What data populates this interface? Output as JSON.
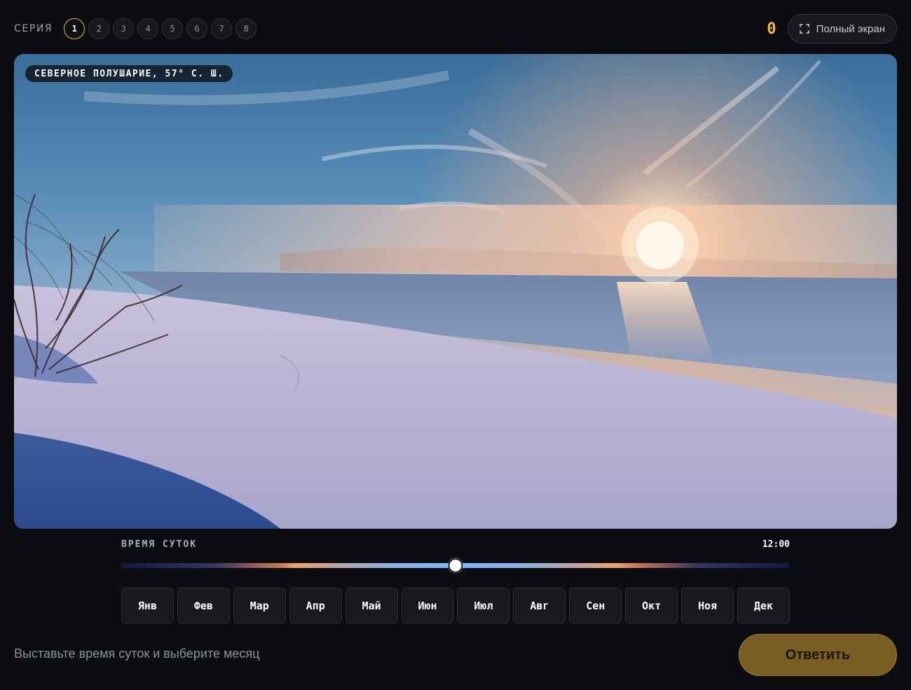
{
  "header": {
    "series_label": "СЕРИЯ",
    "rounds": [
      "1",
      "2",
      "3",
      "4",
      "5",
      "6",
      "7",
      "8"
    ],
    "active_round": 1,
    "score": "0",
    "fullscreen_label": "Полный экран",
    "fullscreen_icon": "fullscreen-icon"
  },
  "photo": {
    "location_chip": "СЕВЕРНОЕ ПОЛУШАРИЕ, 57° С. Ш."
  },
  "time": {
    "label": "ВРЕМЯ СУТОК",
    "value": "12:00",
    "slider_fraction": 0.5
  },
  "months": [
    "Янв",
    "Фев",
    "Мар",
    "Апр",
    "Май",
    "Июн",
    "Июл",
    "Авг",
    "Сен",
    "Окт",
    "Ноя",
    "Дек"
  ],
  "footer": {
    "hint": "Выставьте время суток и выберите месяц",
    "answer_label": "Ответить"
  },
  "colors": {
    "accent": "#f2b740",
    "answer_button": "#7a5d22",
    "background": "#0c0d10"
  }
}
